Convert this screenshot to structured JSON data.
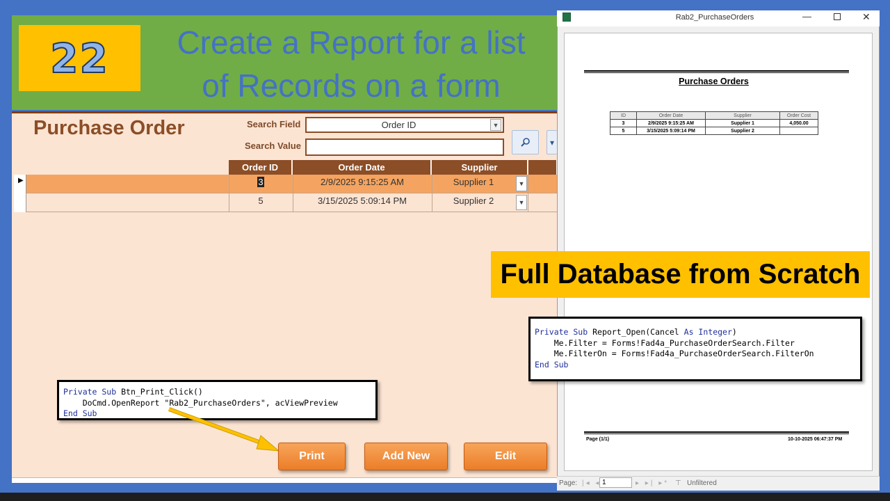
{
  "header": {
    "episode_number": "22",
    "title_line1": "Create a Report for a list",
    "title_line2": "of Records on a form"
  },
  "form": {
    "title": "Purchase Order",
    "search_field_label": "Search Field",
    "search_field_value": "Order ID",
    "search_value_label": "Search Value",
    "search_value": "",
    "columns": [
      "Order ID",
      "Order Date",
      "Supplier"
    ],
    "rows": [
      {
        "order_id": "3",
        "order_date": "2/9/2025 9:15:25 AM",
        "supplier": "Supplier 1",
        "selected": true
      },
      {
        "order_id": "5",
        "order_date": "3/15/2025 5:09:14 PM",
        "supplier": "Supplier 2",
        "selected": false
      }
    ],
    "buttons": {
      "print": "Print",
      "add_new": "Add New",
      "edit": "Edit"
    }
  },
  "code_print": {
    "line1_kw": "Private Sub",
    "line1_rest": " Btn_Print_Click()",
    "line2": "    DoCmd.OpenReport \"Rab2_PurchaseOrders\", acViewPreview",
    "line3_kw": "End Sub"
  },
  "code_report": {
    "line1_kw1": "Private Sub",
    "line1_mid": " Report_Open(Cancel ",
    "line1_kw2": "As Integer",
    "line1_end": ")",
    "line2": "    Me.Filter = Forms!Fad4a_PurchaseOrderSearch.Filter",
    "line3": "    Me.FilterOn = Forms!Fad4a_PurchaseOrderSearch.FilterOn",
    "line4_kw": "End Sub"
  },
  "report_window": {
    "title": "Rab2_PurchaseOrders",
    "report_title": "Purchase Orders",
    "table_headers": [
      "ID",
      "Order Date",
      "Supplier",
      "Order Cost"
    ],
    "table_rows": [
      [
        "3",
        "2/9/2025 9:15:25 AM",
        "Supplier 1",
        "4,050.00"
      ],
      [
        "5",
        "3/15/2025 5:09:14 PM",
        "Supplier 2",
        ""
      ]
    ],
    "footer_page": "Page (1/1)",
    "footer_date": "10-10-2025 06:47:37 PM",
    "status_page_label": "Page:",
    "status_page_value": "1",
    "status_filter": "Unfiltered"
  },
  "banner": {
    "text": "Full Database from Scratch"
  },
  "colors": {
    "header_green": "#70ad47",
    "badge_yellow": "#ffc000",
    "title_blue": "#4472c4",
    "form_brown": "#8b4e27",
    "form_bg": "#fce4d3",
    "selected_row": "#f4a460",
    "button_orange": "#ec7d28"
  }
}
